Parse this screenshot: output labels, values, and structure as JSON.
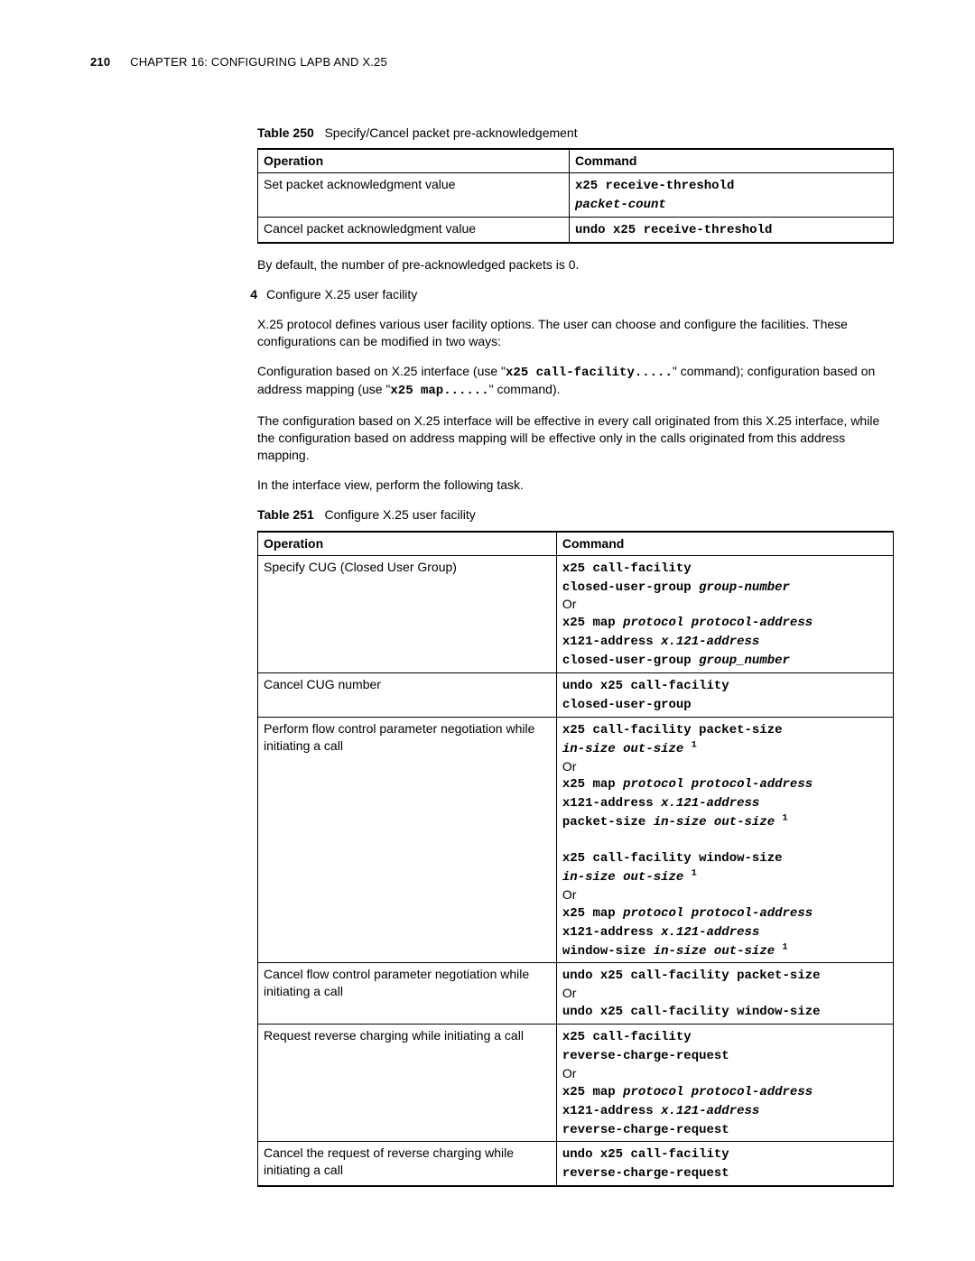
{
  "header": {
    "page_number": "210",
    "chapter_label": "CHAPTER 16: CONFIGURING LAPB AND X.25"
  },
  "table250": {
    "caption_prefix": "Table 250",
    "caption_text": "Specify/Cancel packet pre-acknowledgement",
    "col_operation": "Operation",
    "col_command": "Command",
    "row1_op": "Set packet acknowledgment value",
    "row1_cmd_a": "x25 receive-threshold",
    "row1_cmd_b": "packet-count",
    "row2_op": "Cancel packet acknowledgment value",
    "row2_cmd": "undo x25 receive-threshold"
  },
  "after_t250": "By default, the number of pre-acknowledged packets is 0.",
  "step4_num": "4",
  "step4_title": "Configure X.25 user facility",
  "p1": "X.25 protocol defines various user facility options. The user can choose and configure the facilities. These configurations can be modified in two ways:",
  "p2_a": "Configuration based on X.25 interface (use \"",
  "p2_code1": "x25 call-facility.....",
  "p2_b": "\" command); configuration based on address mapping (use \"",
  "p2_code2": "x25 map......",
  "p2_c": "\" command).",
  "p3": "The configuration based on X.25 interface will be effective in every call originated from this X.25 interface, while the configuration based on address mapping will be effective only in the calls originated from this address mapping.",
  "p4": "In the interface view, perform the following task.",
  "table251": {
    "caption_prefix": "Table 251",
    "caption_text": "Configure X.25 user facility",
    "col_operation": "Operation",
    "col_command": "Command",
    "r1_op": "Specify CUG (Closed User Group)",
    "r1_l1": "x25 call-facility",
    "r1_l2a": "closed-user-group ",
    "r1_l2b": "group-number",
    "r1_l3": "Or",
    "r1_l4a": "x25 map ",
    "r1_l4b": "protocol protocol-address",
    "r1_l5a": "x121-address ",
    "r1_l5b": "x.121-address",
    "r1_l6a": "closed-user-group ",
    "r1_l6b": "group_number",
    "r2_op": "Cancel CUG number",
    "r2_l1": "undo x25 call-facility",
    "r2_l2": "closed-user-group",
    "r3_op": "Perform flow control parameter negotiation while initiating a call",
    "r3_l1": "x25 call-facility packet-size",
    "r3_l2a": "in-size out-size ",
    "r3_l2sup": "1",
    "r3_l3": "Or",
    "r3_l4a": "x25 map ",
    "r3_l4b": "protocol protocol-address",
    "r3_l5a": "x121-address ",
    "r3_l5b": "x.121-address",
    "r3_l6a": "packet-size ",
    "r3_l6b": "in-size out-size ",
    "r3_l6sup": "1",
    "r3_blank": " ",
    "r3_l7": "x25 call-facility window-size",
    "r3_l8a": "in-size out-size ",
    "r3_l8sup": "1",
    "r3_l9": "Or",
    "r3_l10a": "x25 map ",
    "r3_l10b": "protocol protocol-address",
    "r3_l11a": "x121-address ",
    "r3_l11b": "x.121-address",
    "r3_l12a": "window-size ",
    "r3_l12b": "in-size out-size ",
    "r3_l12sup": "1",
    "r4_op": "Cancel flow control parameter negotiation while initiating a call",
    "r4_l1": "undo x25 call-facility packet-size",
    "r4_l2": "Or",
    "r4_l3": "undo x25 call-facility window-size",
    "r5_op": "Request reverse charging while initiating a call",
    "r5_l1": "x25 call-facility",
    "r5_l2": "reverse-charge-request",
    "r5_l3": "Or",
    "r5_l4a": "x25 map ",
    "r5_l4b": "protocol protocol-address",
    "r5_l5a": "x121-address ",
    "r5_l5b": "x.121-address",
    "r5_l6": "reverse-charge-request",
    "r6_op": "Cancel the request of reverse charging while initiating a call",
    "r6_l1": "undo x25 call-facility",
    "r6_l2": "reverse-charge-request"
  }
}
